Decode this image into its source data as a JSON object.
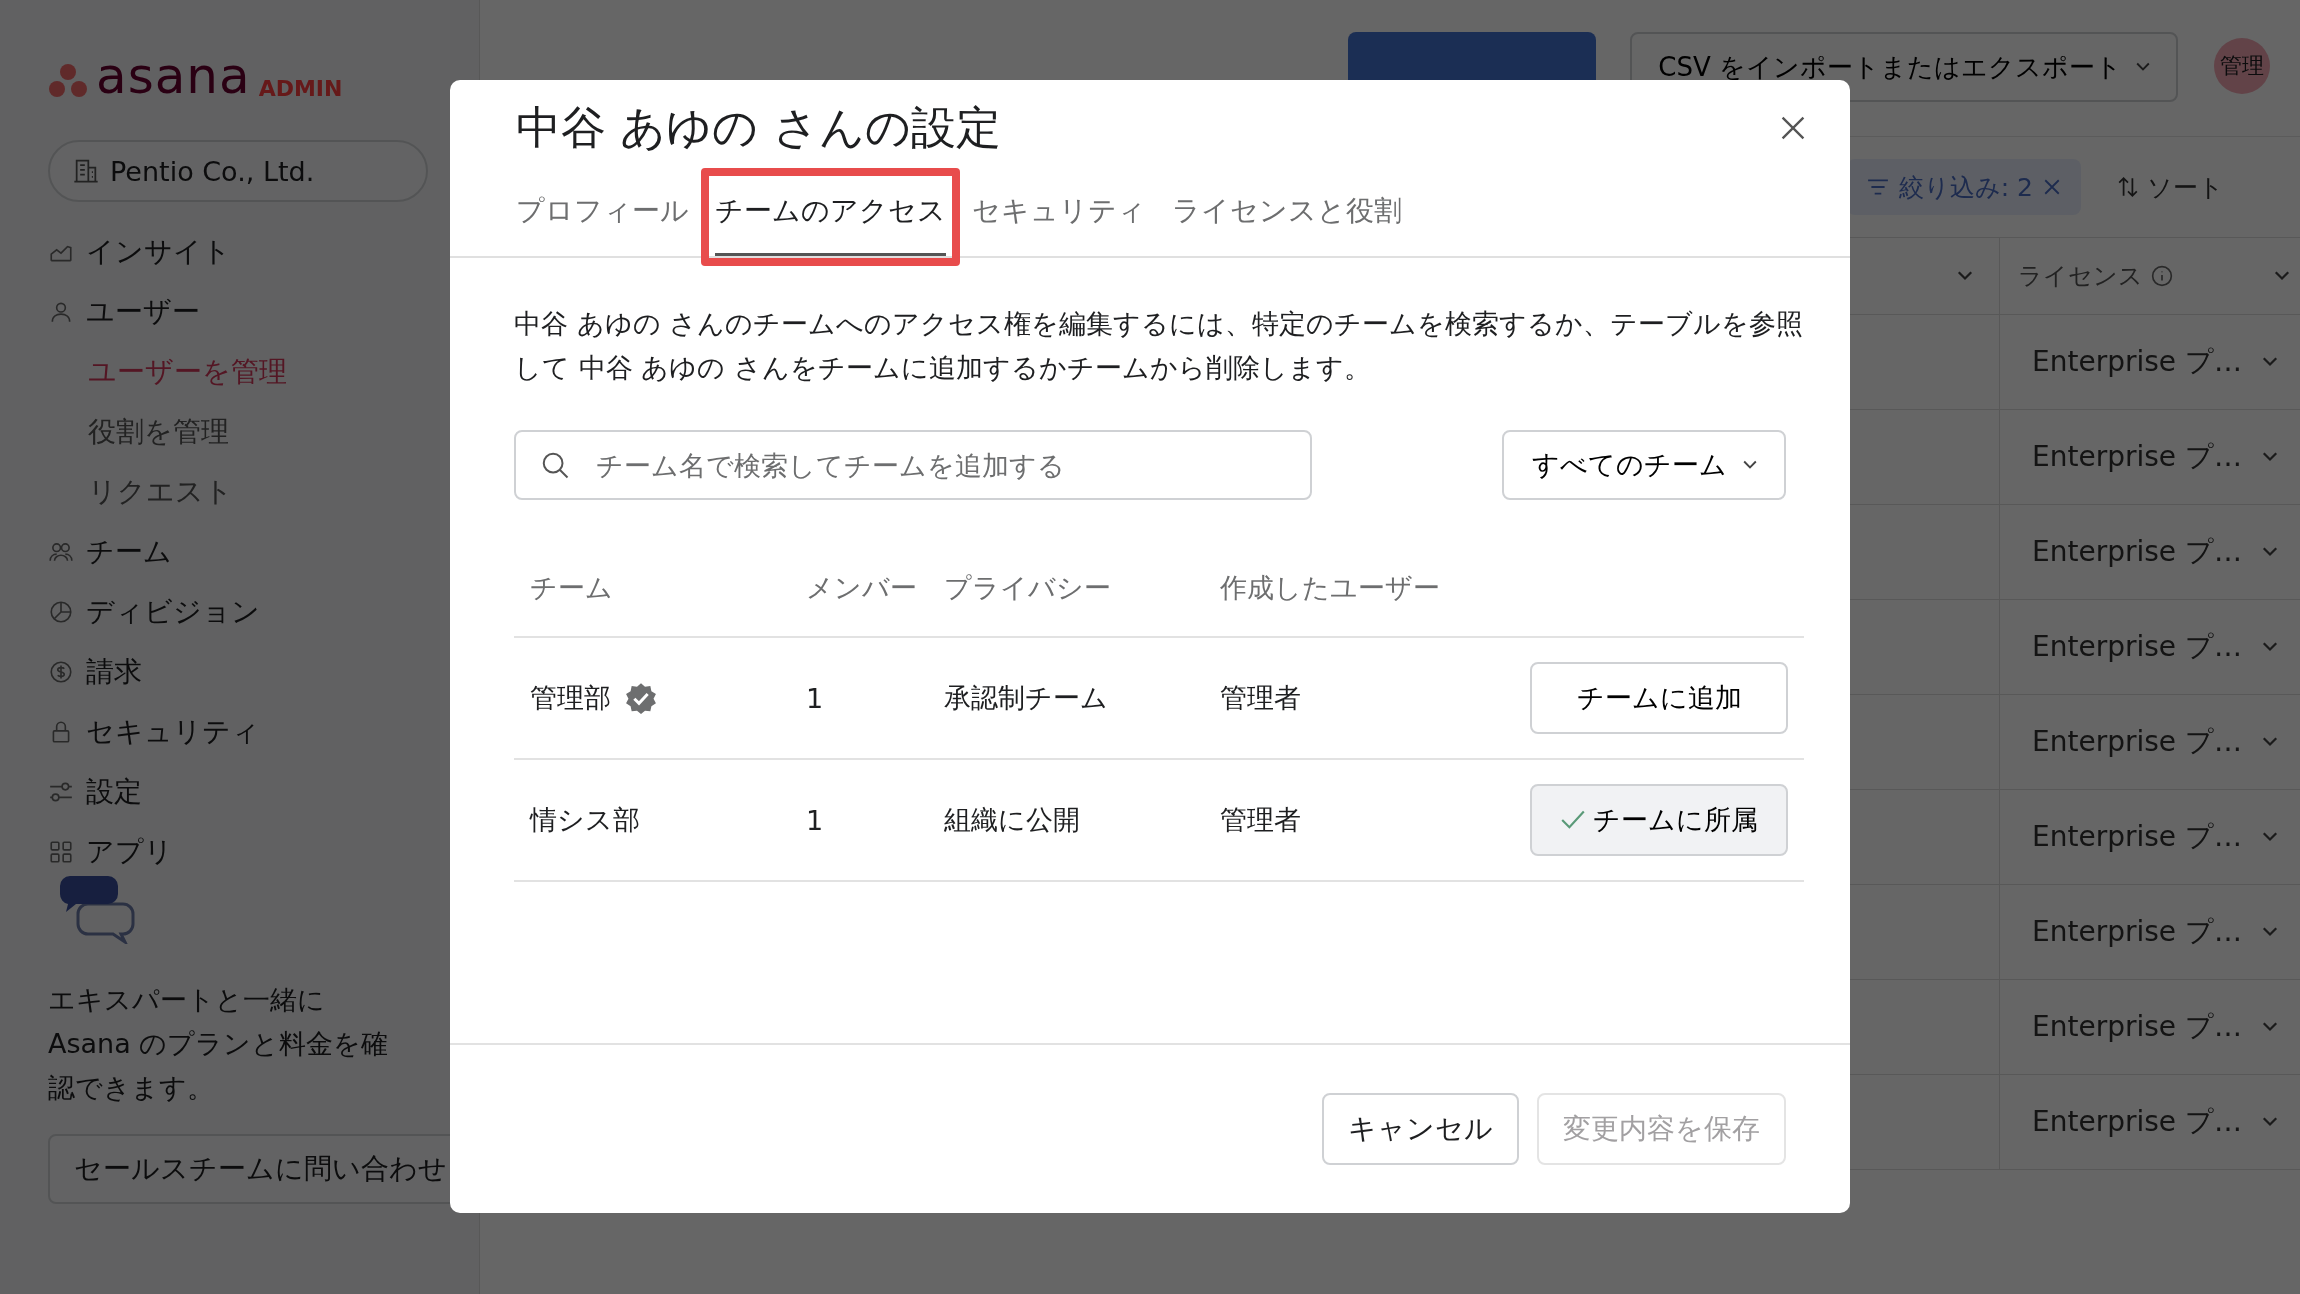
{
  "sidebar": {
    "logo": "asana",
    "logo_badge": "ADMIN",
    "workspace": "Pentio Co., Ltd.",
    "items": [
      {
        "label": "インサイト",
        "selected": false
      },
      {
        "label": "ユーザー",
        "selected": false,
        "children": [
          {
            "label": "ユーザーを管理",
            "selected": true
          },
          {
            "label": "役割を管理",
            "selected": false
          },
          {
            "label": "リクエスト",
            "selected": false
          }
        ]
      },
      {
        "label": "チーム",
        "selected": false
      },
      {
        "label": "ディビジョン",
        "selected": false
      },
      {
        "label": "請求",
        "selected": false
      },
      {
        "label": "セキュリティ",
        "selected": false
      },
      {
        "label": "設定",
        "selected": false
      },
      {
        "label": "アプリ",
        "selected": false
      }
    ],
    "promo": {
      "text": "エキスパートと一緒に Asana のプランと料金を確認できます。",
      "button": "セールスチームに問い合わせ"
    }
  },
  "main": {
    "csv_button": "CSV をインポートまたはエクスポート",
    "avatar": "管理",
    "filter": "絞り込み: 2",
    "sort": "ソート",
    "license_column": "ライセンス",
    "rows": [
      {
        "license": "Enterprise プ…"
      },
      {
        "license": "Enterprise プ…"
      },
      {
        "license": "Enterprise プ…"
      },
      {
        "license": "Enterprise プ…"
      },
      {
        "license": "Enterprise プ…"
      },
      {
        "license": "Enterprise プ…"
      },
      {
        "license": "Enterprise プ…"
      },
      {
        "license": "Enterprise プ…"
      },
      {
        "license": "Enterprise プ…"
      }
    ]
  },
  "dialog": {
    "title": "中谷 あゆの さんの設定",
    "tabs": [
      {
        "label": "プロフィール",
        "selected": false,
        "annotated": false
      },
      {
        "label": "チームのアクセス",
        "selected": true,
        "annotated": true
      },
      {
        "label": "セキュリティ",
        "selected": false,
        "annotated": false
      },
      {
        "label": "ライセンスと役割",
        "selected": false,
        "annotated": false
      }
    ],
    "description": "中谷 あゆの さんのチームへのアクセス権を編集するには、特定のチームを検索するか、テーブルを参照して 中谷 あゆの さんをチームに追加するかチームから削除します。",
    "search": {
      "placeholder": "チーム名で検索してチームを追加する"
    },
    "filter": "すべてのチーム",
    "columns": [
      "チーム",
      "メンバー",
      "プライバシー",
      "作成したユーザー"
    ],
    "rows": [
      {
        "team": "管理部",
        "verified": true,
        "members": "1",
        "privacy": "承認制チーム",
        "creator": "管理者",
        "member": false,
        "action": "チームに追加"
      },
      {
        "team": "情シス部",
        "verified": false,
        "members": "1",
        "privacy": "組織に公開",
        "creator": "管理者",
        "member": true,
        "action": "チームに所属"
      }
    ],
    "buttons": [
      {
        "label": "キャンセル",
        "disabled": false
      },
      {
        "label": "変更内容を保存",
        "disabled": true
      }
    ]
  }
}
